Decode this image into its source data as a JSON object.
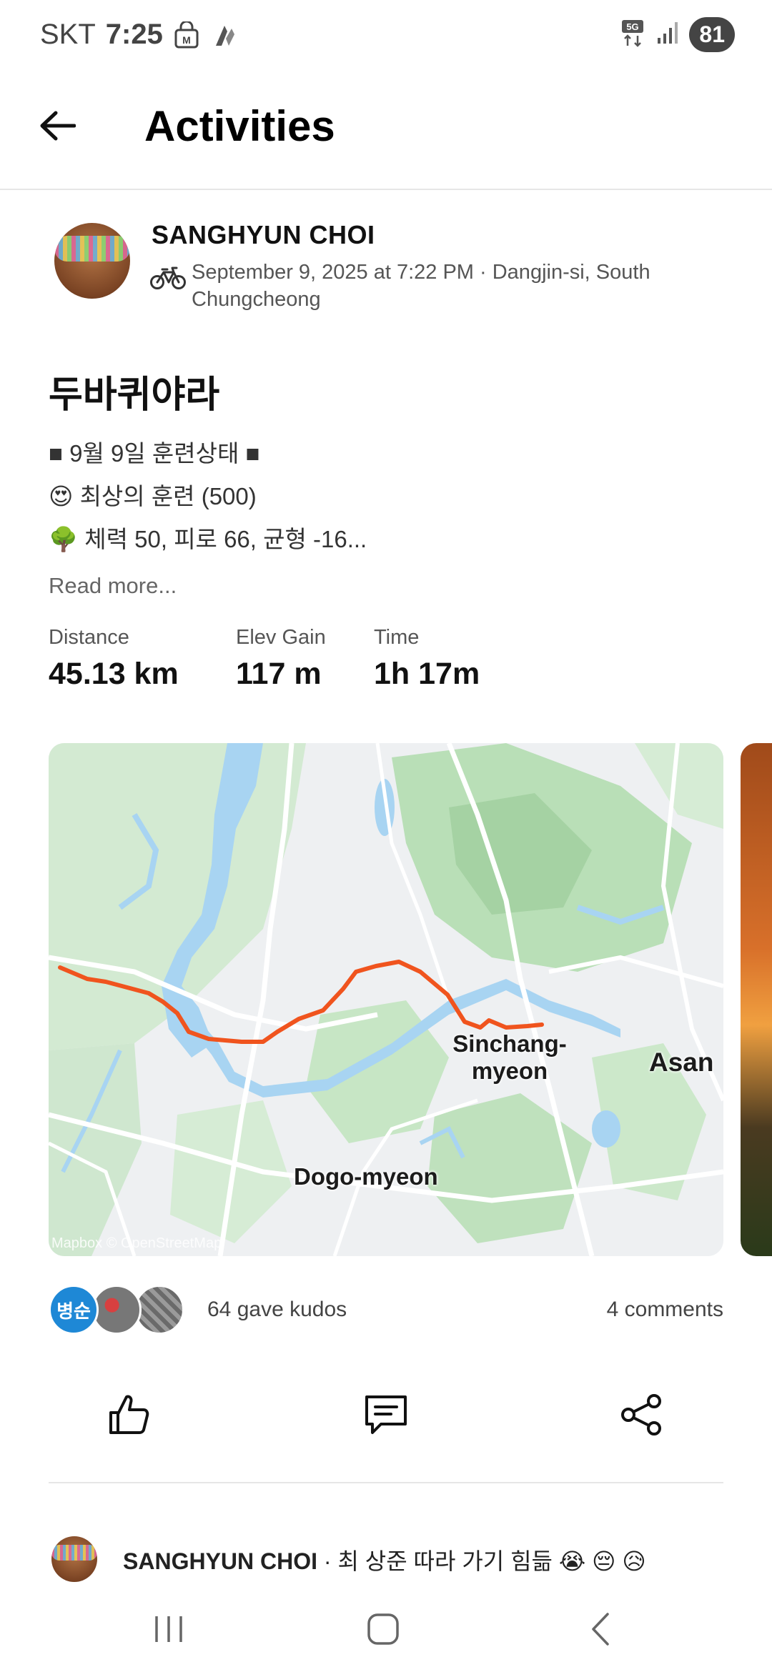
{
  "status_bar": {
    "carrier": "SKT",
    "time": "7:25",
    "network": "5G",
    "battery": "81"
  },
  "header": {
    "title": "Activities"
  },
  "activity": {
    "athlete_name": "SANGHYUN CHOI",
    "date_location": "September 9, 2025 at 7:22 PM · Dangjin-si, South Chungcheong",
    "title": "두바퀴야라",
    "description_lines": [
      "■ 9월 9일 훈련상태 ■",
      "😍 최상의 훈련 (500)",
      "🌳 체력 50, 피로 66, 균형 -16..."
    ],
    "read_more": "Read more...",
    "stats": [
      {
        "label": "Distance",
        "value": "45.13 km"
      },
      {
        "label": "Elev Gain",
        "value": "117 m"
      },
      {
        "label": "Time",
        "value": "1h 17m"
      }
    ]
  },
  "map": {
    "labels": {
      "sinchang": "Sinchang-myeon",
      "asan": "Asan",
      "dogo": "Dogo-myeon"
    },
    "attribution": "Mapbox © OpenStreetMap",
    "route_color": "#f0541e"
  },
  "social": {
    "first_kudoer_initials": "병순",
    "kudos_text": "64 gave kudos",
    "comments_text": "4 comments"
  },
  "comment_preview": {
    "author": "SANGHYUN CHOI",
    "text": " · 최 상준 따라 가기 힘듦 😭 😔 😥"
  },
  "icons": {
    "back": "arrow-left-icon",
    "bike": "bicycle-icon",
    "kudo": "thumbs-up-icon",
    "comment": "comment-icon",
    "share": "share-icon"
  }
}
